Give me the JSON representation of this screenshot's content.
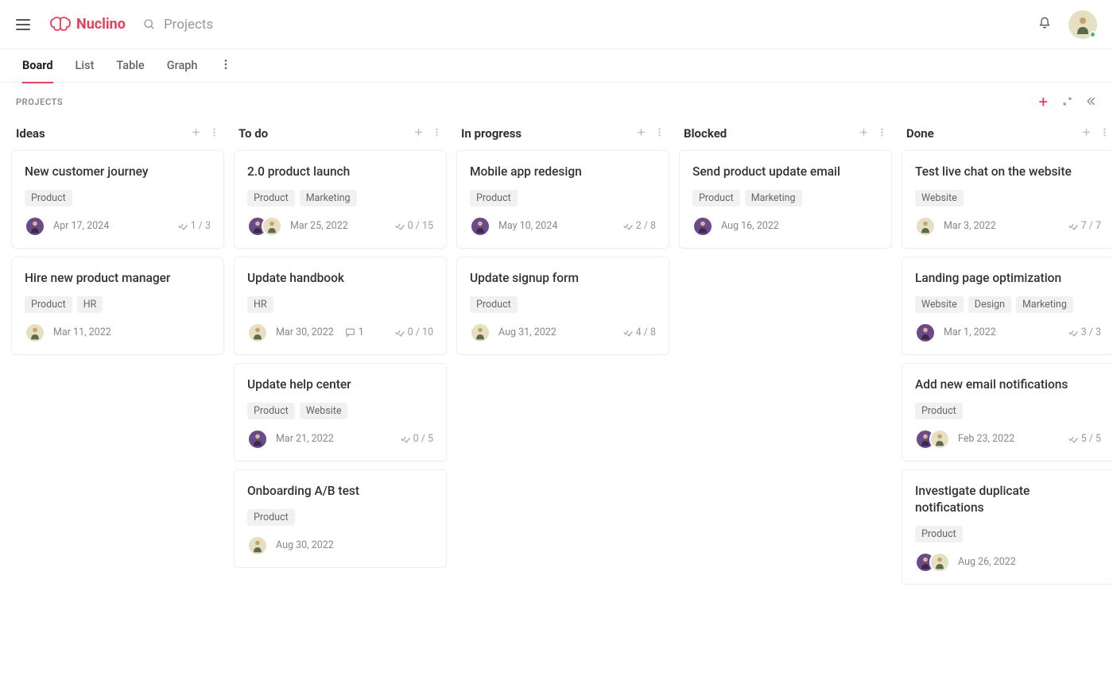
{
  "app": {
    "name": "Nuclino",
    "search_placeholder": "Projects"
  },
  "tabs": [
    "Board",
    "List",
    "Table",
    "Graph"
  ],
  "active_tab": 0,
  "board_title": "PROJECTS",
  "columns": [
    {
      "title": "Ideas",
      "cards": [
        {
          "title": "New customer journey",
          "tags": [
            "Product"
          ],
          "assignees": [
            "purple"
          ],
          "date": "Apr 17, 2024",
          "checklist": "1 / 3"
        },
        {
          "title": "Hire new product manager",
          "tags": [
            "Product",
            "HR"
          ],
          "assignees": [
            "beige"
          ],
          "date": "Mar 11, 2022"
        }
      ]
    },
    {
      "title": "To do",
      "cards": [
        {
          "title": "2.0 product launch",
          "tags": [
            "Product",
            "Marketing"
          ],
          "assignees": [
            "purple",
            "beige"
          ],
          "date": "Mar 25, 2022",
          "checklist": "0 / 15"
        },
        {
          "title": "Update handbook",
          "tags": [
            "HR"
          ],
          "assignees": [
            "beige"
          ],
          "date": "Mar 30, 2022",
          "comments": "1",
          "checklist": "0 / 10"
        },
        {
          "title": "Update help center",
          "tags": [
            "Product",
            "Website"
          ],
          "assignees": [
            "purple"
          ],
          "date": "Mar 21, 2022",
          "checklist": "0 / 5"
        },
        {
          "title": "Onboarding A/B test",
          "tags": [
            "Product"
          ],
          "assignees": [
            "beige"
          ],
          "date": "Aug 30, 2022"
        }
      ]
    },
    {
      "title": "In progress",
      "cards": [
        {
          "title": "Mobile app redesign",
          "tags": [
            "Product"
          ],
          "assignees": [
            "purple"
          ],
          "date": "May 10, 2024",
          "checklist": "2 / 8"
        },
        {
          "title": "Update signup form",
          "tags": [
            "Product"
          ],
          "assignees": [
            "beige"
          ],
          "date": "Aug 31, 2022",
          "checklist": "4 / 8"
        }
      ]
    },
    {
      "title": "Blocked",
      "cards": [
        {
          "title": "Send product update email",
          "tags": [
            "Product",
            "Marketing"
          ],
          "assignees": [
            "purple"
          ],
          "date": "Aug 16, 2022"
        }
      ]
    },
    {
      "title": "Done",
      "cards": [
        {
          "title": "Test live chat on the website",
          "tags": [
            "Website"
          ],
          "assignees": [
            "beige"
          ],
          "date": "Mar 3, 2022",
          "checklist": "7 / 7"
        },
        {
          "title": "Landing page optimization",
          "tags": [
            "Website",
            "Design",
            "Marketing"
          ],
          "assignees": [
            "purple"
          ],
          "date": "Mar 1, 2022",
          "checklist": "3 / 3"
        },
        {
          "title": "Add new email notifications",
          "tags": [
            "Product"
          ],
          "assignees": [
            "purple",
            "beige"
          ],
          "date": "Feb 23, 2022",
          "checklist": "5 / 5"
        },
        {
          "title": "Investigate duplicate notifications",
          "tags": [
            "Product"
          ],
          "assignees": [
            "purple",
            "beige"
          ],
          "date": "Aug 26, 2022"
        }
      ]
    }
  ]
}
